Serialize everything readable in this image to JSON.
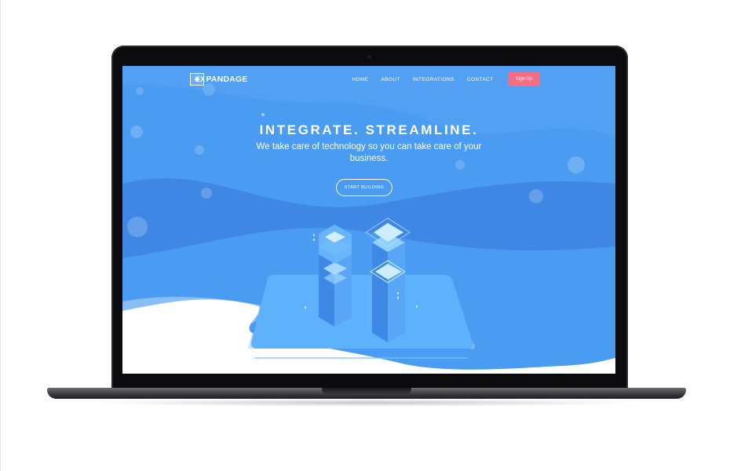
{
  "site": {
    "logo_prefix": "EX",
    "logo_rest": "PANDAGE"
  },
  "nav": {
    "items": [
      "HOME",
      "ABOUT",
      "INTEGRATIONS",
      "CONTACT"
    ],
    "signup_label": "Sign Up"
  },
  "hero": {
    "title": "INTEGRATE. STREAMLINE.",
    "subtitle": "We take care of technology so you can take care of your business.",
    "cta_label": "START BUILDING"
  },
  "colors": {
    "hero_bg": "#4a9bf2",
    "wave_dark": "#3f87e4",
    "signup": "#f66e83",
    "device_frame": "#0b0b0d"
  },
  "icons": [
    "logo-mark-icon",
    "isometric-server-illustration"
  ]
}
